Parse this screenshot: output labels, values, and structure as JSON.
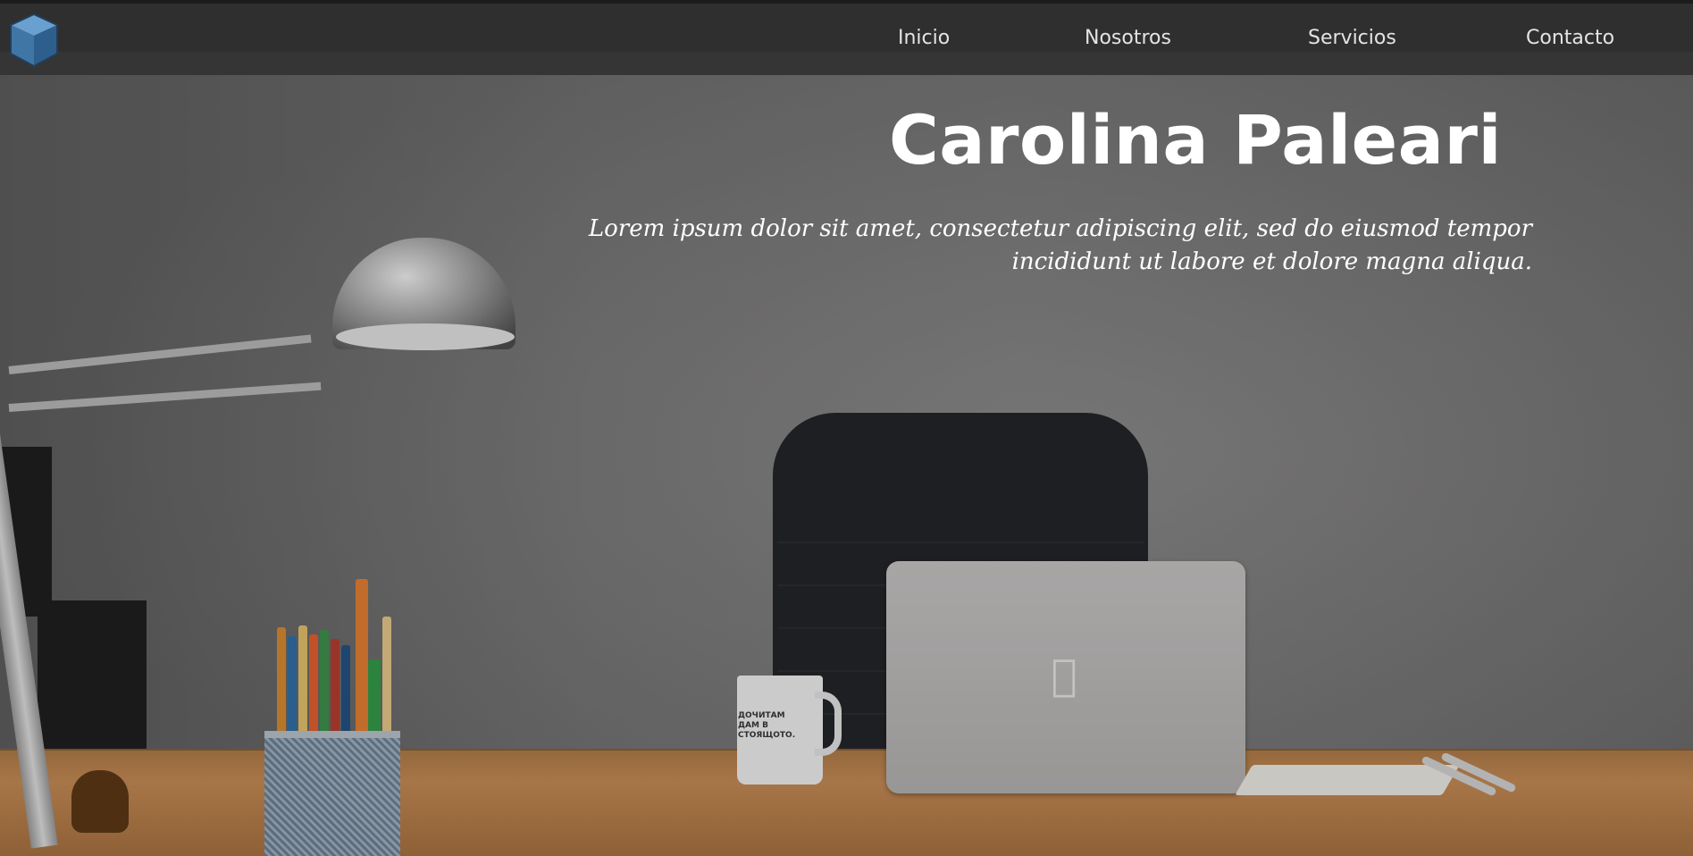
{
  "navbar": {
    "logo_icon": "cube-icon",
    "links": [
      {
        "label": "Inicio"
      },
      {
        "label": "Nosotros"
      },
      {
        "label": "Servicios"
      },
      {
        "label": "Contacto"
      }
    ]
  },
  "hero": {
    "title": "Carolina Paleari",
    "subtitle": "Lorem ipsum dolor sit amet, consectetur adipiscing elit, sed do eiusmod tempor incididunt ut labore et dolore magna aliqua.",
    "mug_text": "ДОЧИТАМ ДАМ В СТОЯЩОТО."
  },
  "colors": {
    "navbar_bg": "#2f2f30",
    "nav_text": "#e4e4e4",
    "hero_text": "#ffffff",
    "logo_blue": "#4f87b8"
  }
}
